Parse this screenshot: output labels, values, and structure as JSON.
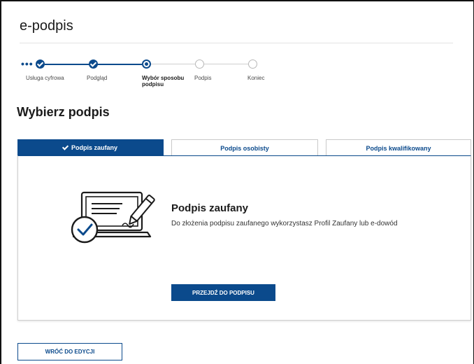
{
  "app": {
    "title": "e-podpis"
  },
  "stepper": {
    "overflow_indicator": "•••",
    "steps": [
      {
        "label": "Usługa cyfrowa",
        "state": "done"
      },
      {
        "label": "Podgląd",
        "state": "done"
      },
      {
        "label_line1": "Wybór sposobu",
        "label_line2": "podpisu",
        "state": "current"
      },
      {
        "label": "Podpis",
        "state": "todo"
      },
      {
        "label": "Koniec",
        "state": "todo"
      }
    ]
  },
  "page": {
    "title": "Wybierz podpis"
  },
  "tabs": [
    {
      "label": "Podpis zaufany",
      "active": true
    },
    {
      "label": "Podpis osobisty",
      "active": false
    },
    {
      "label": "Podpis kwalifikowany",
      "active": false
    }
  ],
  "panel": {
    "icon": "laptop-signature-check-icon",
    "heading": "Podpis zaufany",
    "description": "Do złożenia podpisu zaufanego wykorzystasz Profil Zaufany lub e-dowód",
    "primary_button": "PRZEJDŹ DO PODPISU"
  },
  "footer": {
    "back_button": "WRÓĆ DO EDYCJI"
  },
  "colors": {
    "accent": "#0b4a8c",
    "border": "#cfcfcf",
    "text": "#1b1b1b"
  }
}
